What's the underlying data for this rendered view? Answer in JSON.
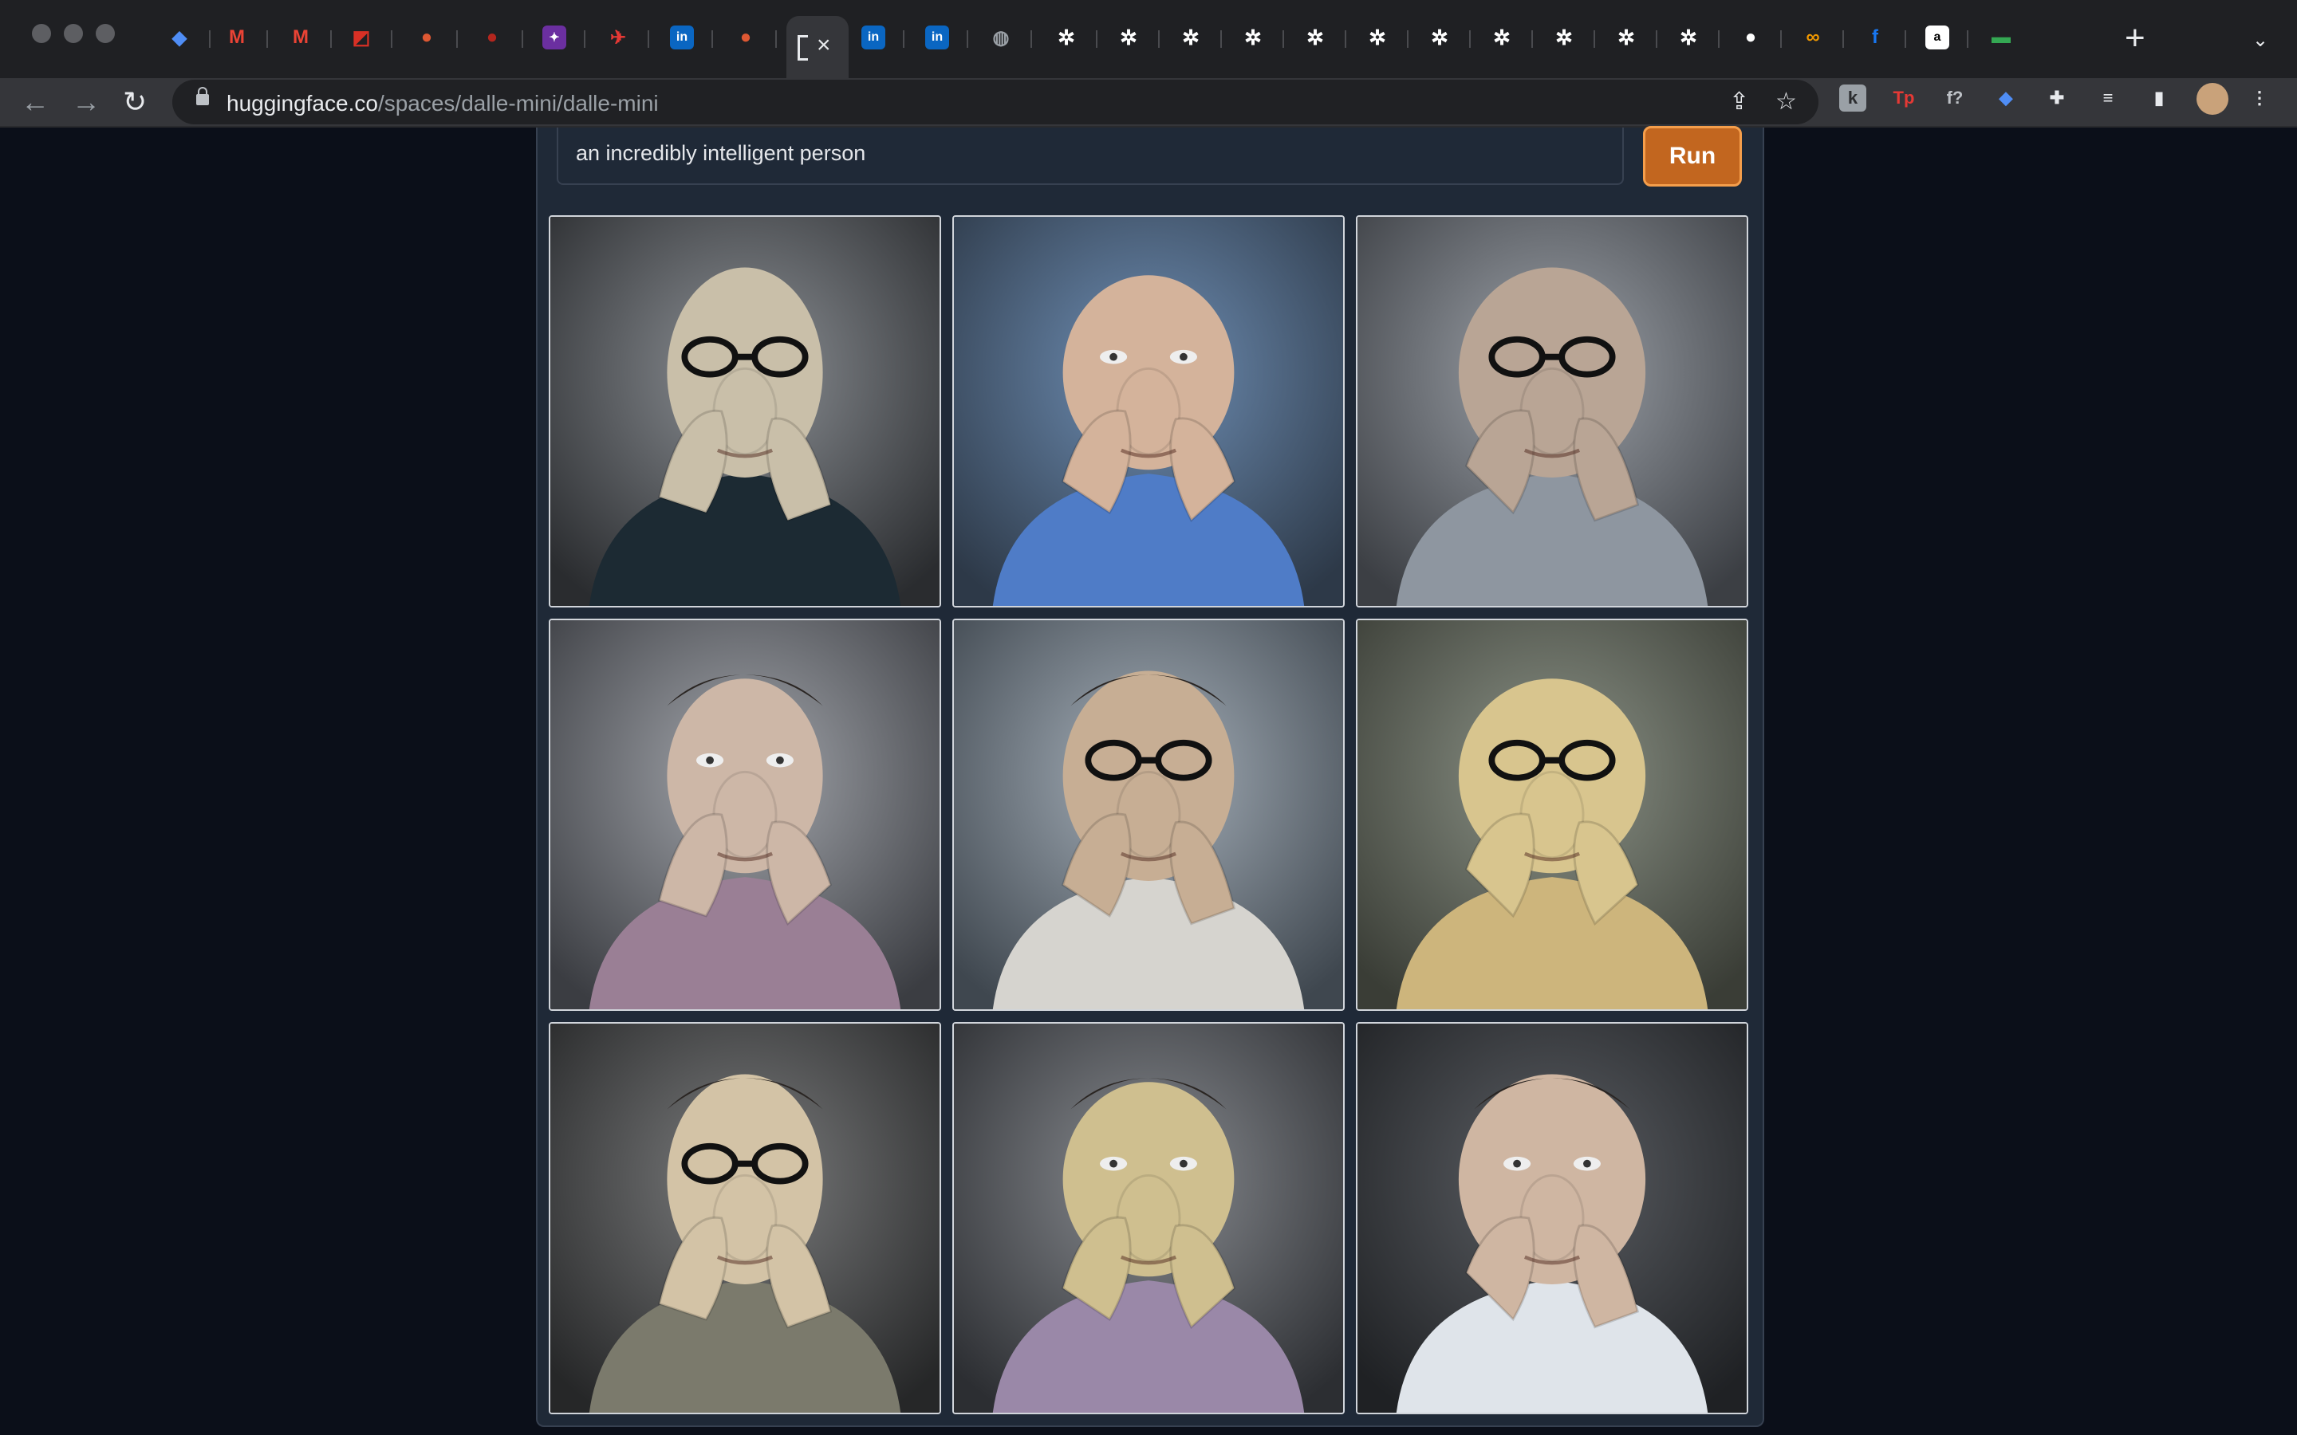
{
  "browser": {
    "url_host": "huggingface.co",
    "url_path": "/spaces/dalle-mini/dalle-mini",
    "new_tab_symbol": "+",
    "close_tab_symbol": "×",
    "tabs": [
      {
        "icon": "diamond-icon",
        "color": "#4f8df5"
      },
      {
        "icon": "gmail-icon",
        "color": "#ea4335"
      },
      {
        "icon": "gmail-icon",
        "color": "#ea4335"
      },
      {
        "icon": "flag-icon",
        "color": "#d93025"
      },
      {
        "icon": "duckduckgo-icon",
        "color": "#de5833"
      },
      {
        "icon": "red-circle-icon",
        "color": "#b3261e"
      },
      {
        "icon": "purple-app-icon",
        "color": "#6b2fa0"
      },
      {
        "icon": "red-bird-icon",
        "color": "#e53935"
      },
      {
        "icon": "linkedin-icon",
        "color": "#0a66c2"
      },
      {
        "icon": "duckduckgo-icon",
        "color": "#de5833"
      },
      {
        "icon": "linkedin-icon",
        "color": "#0a66c2"
      },
      {
        "icon": "linkedin-icon",
        "color": "#0a66c2"
      },
      {
        "icon": "globe-icon",
        "color": "#9aa0a6"
      },
      {
        "icon": "gear-icon",
        "color": "#ffffff"
      },
      {
        "icon": "gear-icon",
        "color": "#ffffff"
      },
      {
        "icon": "gear-icon",
        "color": "#ffffff"
      },
      {
        "icon": "gear-icon",
        "color": "#ffffff"
      },
      {
        "icon": "gear-icon",
        "color": "#ffffff"
      },
      {
        "icon": "gear-icon",
        "color": "#ffffff"
      },
      {
        "icon": "gear-icon",
        "color": "#ffffff"
      },
      {
        "icon": "gear-icon",
        "color": "#ffffff"
      },
      {
        "icon": "gear-icon",
        "color": "#ffffff"
      },
      {
        "icon": "gear-icon",
        "color": "#ffffff"
      },
      {
        "icon": "gear-icon",
        "color": "#ffffff"
      },
      {
        "icon": "github-icon",
        "color": "#ffffff"
      },
      {
        "icon": "infinity-icon",
        "color": "#f29900"
      },
      {
        "icon": "facebook-icon",
        "color": "#1877f2"
      },
      {
        "icon": "amazon-icon",
        "color": "#ffffff"
      },
      {
        "icon": "battery-icon",
        "color": "#34a853"
      }
    ],
    "extensions": [
      {
        "icon": "k-extension-icon",
        "label": "k"
      },
      {
        "icon": "tp-extension-icon",
        "label": "Tp"
      },
      {
        "icon": "fx-extension-icon",
        "label": "f?"
      },
      {
        "icon": "diamond-extension-icon",
        "label": ""
      },
      {
        "icon": "puzzle-icon",
        "label": ""
      },
      {
        "icon": "media-control-icon",
        "label": ""
      },
      {
        "icon": "side-panel-icon",
        "label": ""
      },
      {
        "icon": "profile-avatar",
        "label": ""
      },
      {
        "icon": "kebab-menu-icon",
        "label": "⋮"
      }
    ]
  },
  "app": {
    "prompt_value": "an incredibly intelligent person",
    "run_label": "Run",
    "accent_color": "#c2661f",
    "images": [
      {
        "name": "generated-image-1",
        "bg": [
          "#8d9196",
          "#2a2c2f"
        ],
        "skin": "#c9bfa9",
        "shirt": "#1c2a33",
        "glasses": true
      },
      {
        "name": "generated-image-2",
        "bg": [
          "#6f8fb5",
          "#2d3948"
        ],
        "skin": "#d4b39b",
        "shirt": "#4f7cc7",
        "glasses": false
      },
      {
        "name": "generated-image-3",
        "bg": [
          "#9fa4ab",
          "#3c3f44"
        ],
        "skin": "#b9a595",
        "shirt": "#8e96a0",
        "glasses": true
      },
      {
        "name": "generated-image-4",
        "bg": [
          "#a4a7ad",
          "#3b3d42"
        ],
        "skin": "#cdb7a7",
        "shirt": "#9a7f95",
        "glasses": false
      },
      {
        "name": "generated-image-5",
        "bg": [
          "#a7b1bb",
          "#3f474f"
        ],
        "skin": "#c7ae94",
        "shirt": "#d6d4cf",
        "glasses": true
      },
      {
        "name": "generated-image-6",
        "bg": [
          "#8d9488",
          "#3a3d36"
        ],
        "skin": "#d8c58e",
        "shirt": "#cdb57c",
        "glasses": true
      },
      {
        "name": "generated-image-7",
        "bg": [
          "#7c7d7e",
          "#262728"
        ],
        "skin": "#d3c3a6",
        "shirt": "#7b7a6c",
        "glasses": true
      },
      {
        "name": "generated-image-8",
        "bg": [
          "#8a8d92",
          "#2c2e32"
        ],
        "skin": "#cfbf8f",
        "shirt": "#9a88a8",
        "glasses": false
      },
      {
        "name": "generated-image-9",
        "bg": [
          "#5d6065",
          "#1f2124"
        ],
        "skin": "#cfb6a2",
        "shirt": "#dfe4ea",
        "glasses": false
      }
    ]
  }
}
